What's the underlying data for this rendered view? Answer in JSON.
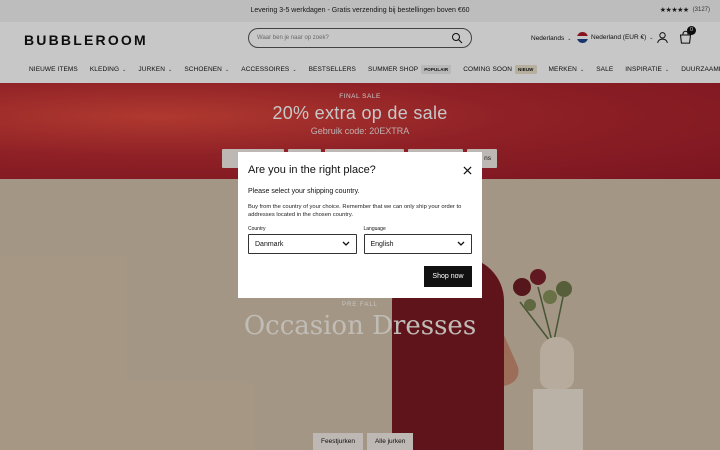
{
  "topbar": {
    "shipping_text": "Levering 3-5 werkdagen - Gratis verzending bij bestellingen boven €60",
    "rating_stars": "★★★★★",
    "rating_count": "(3127)"
  },
  "header": {
    "logo": "BUBBLEROOM",
    "search_placeholder": "Waar ben je naar op zoek?",
    "language": "Nederlands",
    "region": "Nederland (EUR €)",
    "cart_count": "0"
  },
  "nav": {
    "items": [
      {
        "label": "NIEUWE ITEMS"
      },
      {
        "label": "KLEDING",
        "chevron": true
      },
      {
        "label": "JURKEN",
        "chevron": true
      },
      {
        "label": "SCHOENEN",
        "chevron": true
      },
      {
        "label": "ACCESSOIRES",
        "chevron": true
      },
      {
        "label": "BESTSELLERS"
      },
      {
        "label": "SUMMER SHOP",
        "badge": "POPULAIR"
      },
      {
        "label": "COMING SOON",
        "badge": "NIEUW"
      },
      {
        "label": "MERKEN",
        "chevron": true
      },
      {
        "label": "SALE"
      },
      {
        "label": "INSPIRATIE",
        "chevron": true
      },
      {
        "label": "DUURZAAMHEID",
        "chevron": true
      }
    ]
  },
  "promo": {
    "kicker": "FINAL SALE",
    "headline": "20% extra op de sale",
    "code": "Gebruik code: 20EXTRA",
    "buttons": [
      "Sh",
      "",
      "",
      "",
      "ns"
    ]
  },
  "hero": {
    "kicker": "PRE FALL",
    "title": "Occasion Dresses",
    "buttons": [
      "Feestjurken",
      "Alle jurken"
    ]
  },
  "modal": {
    "title": "Are you in the right place?",
    "subtitle": "Please select your shipping country.",
    "body": "Buy from the country of your choice. Remember that we can only ship your order to addresses located in the chosen country.",
    "country_label": "Country",
    "country_value": "Danmark",
    "language_label": "Language",
    "language_value": "English",
    "submit_label": "Shop now"
  },
  "colors": {
    "promo_red": "#b72a31",
    "hero_beige": "#d3c1a9",
    "dress": "#7a1a24"
  }
}
